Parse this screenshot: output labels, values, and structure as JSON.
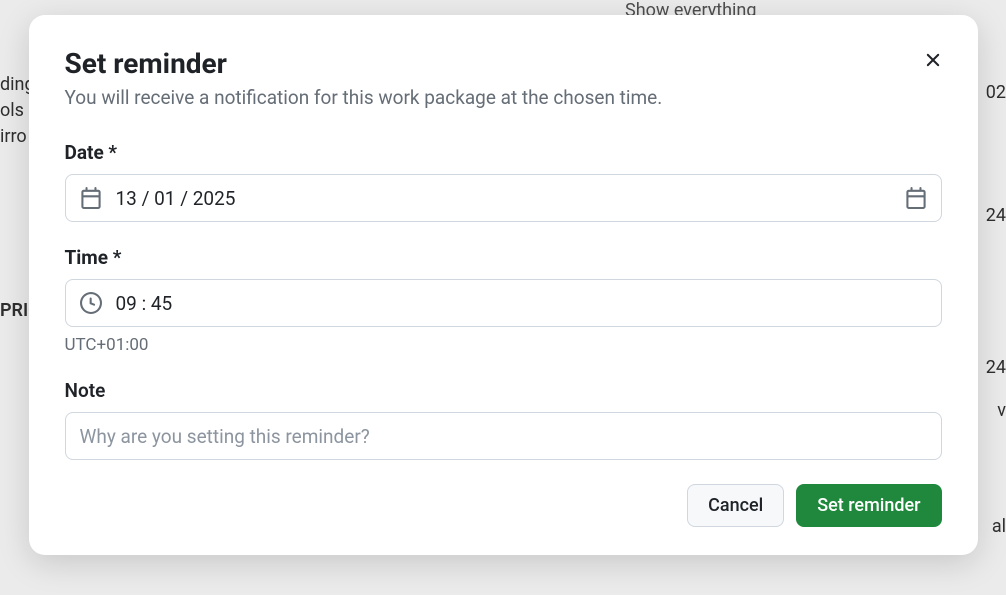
{
  "backdrop": {
    "text1": "ding",
    "text2": "ols",
    "text3": "irro",
    "text4": "PRIO",
    "text5": "Show everything",
    "text6": "02",
    "text7": "24",
    "text8": "al",
    "text9": "v"
  },
  "modal": {
    "title": "Set reminder",
    "subtitle": "You will receive a notification for this work package at the chosen time.",
    "date": {
      "label": "Date *",
      "value": "13 / 01 / 2025"
    },
    "time": {
      "label": "Time *",
      "value": "09 : 45",
      "helper": "UTC+01:00"
    },
    "note": {
      "label": "Note",
      "placeholder": "Why are you setting this reminder?"
    },
    "buttons": {
      "cancel": "Cancel",
      "submit": "Set reminder"
    }
  }
}
